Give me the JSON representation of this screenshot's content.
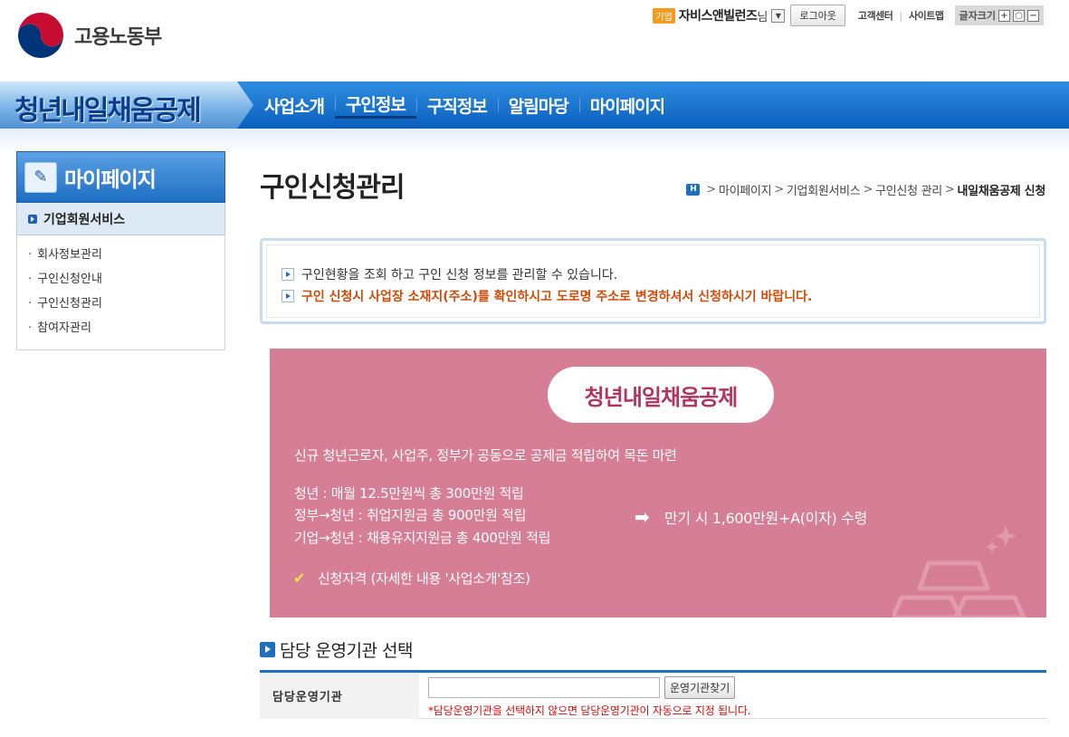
{
  "header": {
    "logo_text": "고용노동부",
    "user_badge": "기업",
    "user_name": "자비스앤빌런즈",
    "user_suffix": "님",
    "logout_label": "로그아웃",
    "links": [
      "고객센터",
      "사이트맵"
    ],
    "font_size_label": "글자크기",
    "font_size_controls": [
      "+",
      "○",
      "−"
    ]
  },
  "gnb": {
    "brand": "청년내일채움공제",
    "menu": [
      "사업소개",
      "구인정보",
      "구직정보",
      "알림마당",
      "마이페이지"
    ],
    "active_index": 1
  },
  "lnb": {
    "title": "마이페이지",
    "section": "기업회원서비스",
    "items": [
      "회사정보관리",
      "구인신청안내",
      "구인신청관리",
      "참여자관리"
    ]
  },
  "main": {
    "page_title": "구인신청관리",
    "breadcrumb": {
      "home": "H",
      "items": [
        "마이페이지",
        "기업회원서비스",
        "구인신청 관리"
      ],
      "current": "내일채움공제 신청"
    },
    "info": {
      "line1": "구인현황을 조회 하고 구인 신청 정보를 관리할 수 있습니다.",
      "line2": "구인 신청시 사업장 소재지(주소)를 확인하시고 도로명 주소로 변경하셔서 신청하시기 바랍니다."
    },
    "banner": {
      "title": "청년내일채움공제",
      "subtitle": "신규 청년근로자, 사업주, 정부가 공동으로 공제금 적립하여 목돈 마련",
      "rows": [
        "청년 : 매월 12.5만원씩 총 300만원 적립",
        "정부→청년 : 취업지원금 총 900만원 적립",
        "기업→청년 : 채용유지지원금 총 400만원 적립"
      ],
      "result": "만기 시 1,600만원+A(이자) 수령",
      "qualification": "신청자격 (자세한 내용 '사업소개'참조)"
    },
    "section_title": "담당 운영기관 선택",
    "form": {
      "label": "담당운영기관",
      "input_value": "",
      "search_button": "운영기관찾기",
      "note": "*담당운영기관을 선택하지 않으면 담당운영기관이 자동으로 지정 됩니다."
    }
  },
  "colors": {
    "gnb_blue": "#0a5fbd",
    "banner_pink": "#d57e95",
    "banner_title": "#b1355e",
    "warning_orange": "#d14b07",
    "note_red": "#d10d0d"
  }
}
